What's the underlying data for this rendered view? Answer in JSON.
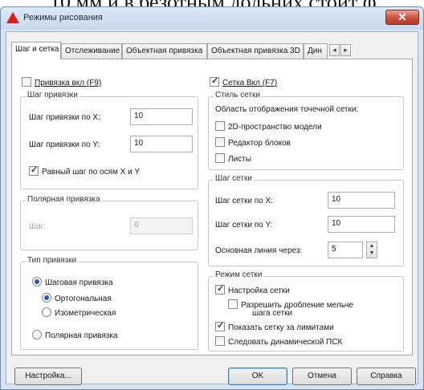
{
  "background_text": "10 мм и в безотным дольних стоит ф",
  "window": {
    "title": "Режимы рисования",
    "close_label": "✕"
  },
  "tabs": [
    {
      "label": "Шаг и сетка",
      "active": true
    },
    {
      "label": "Отслеживание",
      "active": false
    },
    {
      "label": "Объектная привязка",
      "active": false
    },
    {
      "label": "Объектная привязка 3D",
      "active": false
    },
    {
      "label": "Дин",
      "active": false
    }
  ],
  "tab_scroll": {
    "left": "◂",
    "right": "▸"
  },
  "snap": {
    "enabled_label": "Привязка вкл (F9)",
    "enabled": false,
    "spacing_group_title": "Шаг привязки",
    "x_label": "Шаг привязки по X:",
    "x_value": "10",
    "y_label": "Шаг привязки по Y:",
    "y_value": "10",
    "equal_label": "Равный шаг по осям X и Y",
    "equal_checked": true,
    "polar_group_title": "Полярная привязка",
    "polar_label": "Шаг:",
    "polar_value": "0",
    "type_group_title": "Тип привязки",
    "type_grid_label": "Шаговая привязка",
    "type_rect_label": "Ортогональная",
    "type_iso_label": "Изометрическая",
    "type_polar_label": "Полярная привязка"
  },
  "grid": {
    "enabled_label": "Сетка Вкл (F7)",
    "enabled": true,
    "style_group_title": "Стиль сетки",
    "style_desc": "Область отображения точечной сетки:",
    "style_model_label": "2D-пространство модели",
    "style_block_label": "Редактор блоков",
    "style_sheet_label": "Листы",
    "spacing_group_title": "Шаг сетки",
    "x_label": "Шаг сетки по X:",
    "x_value": "10",
    "y_label": "Шаг сетки по Y:",
    "y_value": "10",
    "major_label": "Основная линия через:",
    "major_value": "5",
    "behavior_group_title": "Режим сетки",
    "adaptive_label": "Настройка сетки",
    "adaptive_checked": true,
    "subdivision_label_line1": "Разрешить дробление мельче",
    "subdivision_label_line2": "шага сетки",
    "subdivision_checked": false,
    "beyond_limits_label": "Показать сетку за лимитами",
    "beyond_limits_checked": true,
    "follow_ucs_label": "Следовать динамической ПСК",
    "follow_ucs_checked": false
  },
  "buttons": {
    "options": "Настройка...",
    "ok": "OK",
    "cancel": "Отмена",
    "help": "Справка"
  }
}
